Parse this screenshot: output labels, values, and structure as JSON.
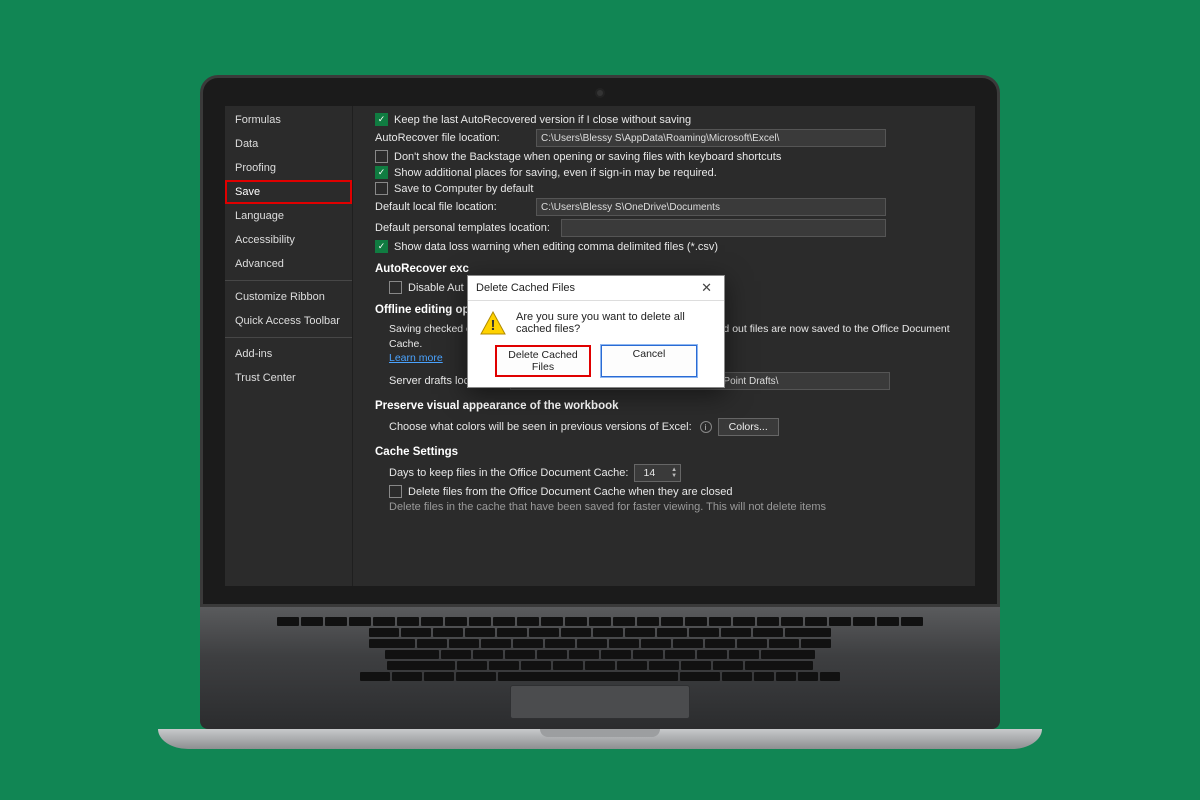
{
  "sidebar": {
    "items": [
      {
        "label": "Formulas"
      },
      {
        "label": "Data"
      },
      {
        "label": "Proofing"
      },
      {
        "label": "Save",
        "selected": true
      },
      {
        "label": "Language"
      },
      {
        "label": "Accessibility"
      },
      {
        "label": "Advanced"
      }
    ],
    "items2": [
      {
        "label": "Customize Ribbon"
      },
      {
        "label": "Quick Access Toolbar"
      }
    ],
    "items3": [
      {
        "label": "Add-ins"
      },
      {
        "label": "Trust Center"
      }
    ]
  },
  "opts": {
    "keep_last": "Keep the last AutoRecovered version if I close without saving",
    "ar_loc_label": "AutoRecover file location:",
    "ar_loc_val": "C:\\Users\\Blessy S\\AppData\\Roaming\\Microsoft\\Excel\\",
    "no_backstage": "Don't show the Backstage when opening or saving files with keyboard shortcuts",
    "show_addl": "Show additional places for saving, even if sign-in may be required.",
    "save_default": "Save to Computer by default",
    "def_loc_label": "Default local file location:",
    "def_loc_val": "C:\\Users\\Blessy S\\OneDrive\\Documents",
    "pt_label": "Default personal templates location:",
    "csv_warn": "Show data loss warning when editing comma delimited files (*.csv)"
  },
  "sections": {
    "ar_exc": "AutoRecover exc",
    "disable_ar": "Disable Aut",
    "offline": "Offline editing op",
    "offline_note": "Saving checked out files to server drafts is no longer supported. Checked out files are now saved to the Office Document Cache.",
    "learn_more": "Learn more",
    "server_label": "Server drafts location:",
    "server_val": "C:\\Users\\Blessy S\\OneDrive\\Documents\\SharePoint Drafts\\",
    "preserve": "Preserve visual appearance of the workbook",
    "colors_note": "Choose what colors will be seen in previous versions of Excel:",
    "colors_btn": "Colors...",
    "cache": "Cache Settings",
    "cache_days_label": "Days to keep files in the Office Document Cache:",
    "cache_days": "14",
    "cache_delete": "Delete files from the Office Document Cache when they are closed",
    "cache_partial": "Delete files in the cache that have been saved for faster viewing. This will not delete items"
  },
  "dialog": {
    "title": "Delete Cached Files",
    "msg": "Are you sure you want to delete all cached files?",
    "primary": "Delete Cached Files",
    "secondary": "Cancel"
  }
}
